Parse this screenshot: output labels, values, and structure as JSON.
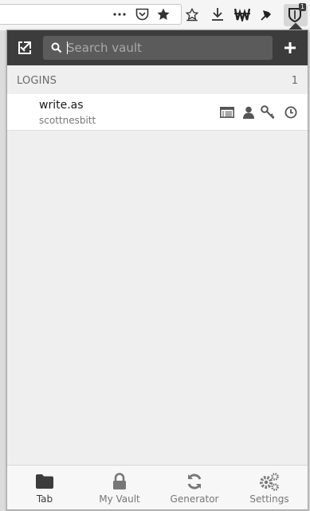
{
  "browser": {
    "toolbar_icons": [
      "more-icon",
      "pocket-icon",
      "bookmark-star-icon",
      "library-icon",
      "download-icon",
      "extension-w-icon",
      "pin-icon",
      "bitwarden-icon"
    ],
    "extension_badge": "1"
  },
  "popup": {
    "header": {
      "search_placeholder": "Search vault",
      "search_value": "",
      "left_icon": "popout-icon",
      "right_icon": "add-icon"
    },
    "section": {
      "title": "LOGINS",
      "count": "1"
    },
    "items": [
      {
        "name": "write.as",
        "username": "scottnesbitt",
        "actions": [
          "launch-icon",
          "copy-username-icon",
          "copy-password-icon",
          "copy-totp-icon"
        ]
      }
    ],
    "tabs": [
      {
        "label": "Tab",
        "icon": "folder-icon",
        "active": true
      },
      {
        "label": "My Vault",
        "icon": "lock-icon",
        "active": false
      },
      {
        "label": "Generator",
        "icon": "refresh-icon",
        "active": false
      },
      {
        "label": "Settings",
        "icon": "cogs-icon",
        "active": false
      }
    ]
  },
  "colors": {
    "header_bg": "#3c3c3c",
    "search_bg": "#5b5b5b",
    "body_bg": "#efefef",
    "text_muted": "#6a6a6a",
    "icon_color": "#555555"
  }
}
